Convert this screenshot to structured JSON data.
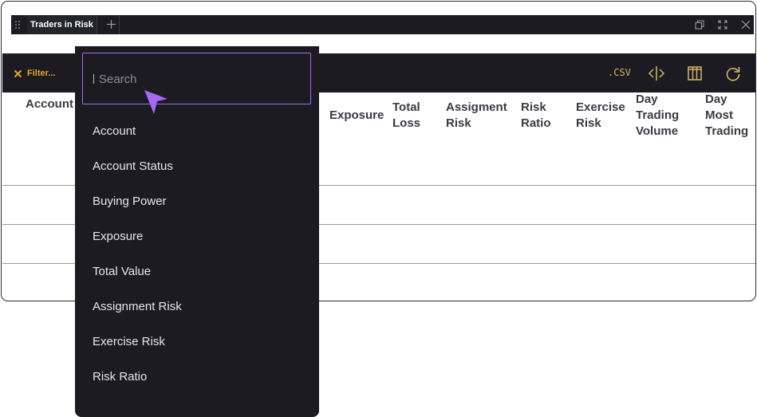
{
  "window": {
    "tab_label": "Traders in Risk"
  },
  "toolbar": {
    "filter_label": "Filter...",
    "csv_label": ".CSV"
  },
  "table": {
    "columns": [
      {
        "label": "Account"
      },
      {
        "label": "Exposure"
      },
      {
        "label": "Total Loss"
      },
      {
        "label": "Assigment Risk"
      },
      {
        "label": "Risk Ratio"
      },
      {
        "label": "Exercise Risk"
      },
      {
        "label": "Day Trading Volume"
      },
      {
        "label": "Day Most Trading"
      }
    ]
  },
  "dropdown": {
    "search_placeholder": "Search",
    "search_value": "",
    "options": [
      {
        "label": "Account"
      },
      {
        "label": "Account Status"
      },
      {
        "label": "Buying Power"
      },
      {
        "label": "Exposure"
      },
      {
        "label": "Total Value"
      },
      {
        "label": "Assignment Risk"
      },
      {
        "label": "Exercise Risk"
      },
      {
        "label": "Risk Ratio"
      }
    ]
  },
  "colors": {
    "panel_dark": "#1b1b21",
    "accent_orange": "#e2a52a",
    "csv_gold": "#d8b46a",
    "focus_purple": "#9c72f4",
    "cursor_purple": "#a569f7"
  },
  "icons": {
    "drag_handle": "drag-handle-icon",
    "add_tab": "plus-icon",
    "popout": "popout-icon",
    "maximize": "maximize-icon",
    "close": "close-icon",
    "filter_clear": "x-icon",
    "columns_resize": "split-columns-icon",
    "columns": "columns-icon",
    "refresh": "refresh-icon",
    "pointer": "mouse-pointer-icon"
  }
}
